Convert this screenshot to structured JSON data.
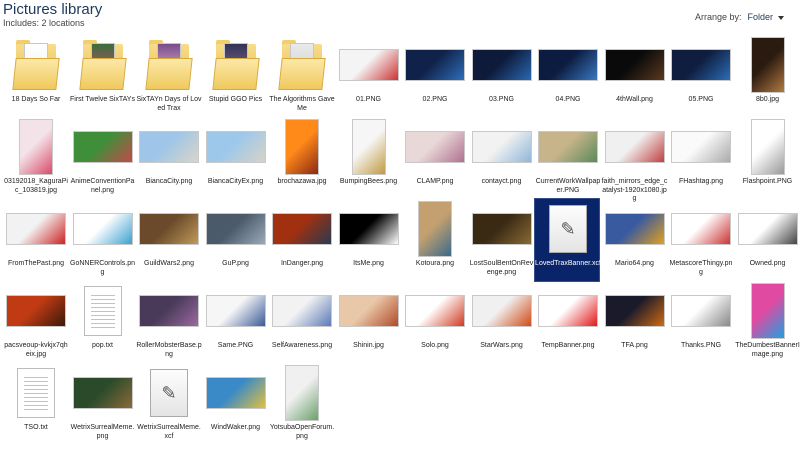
{
  "header": {
    "title": "Pictures library",
    "includes": "Includes:  2 locations",
    "arrange_label": "Arrange by:",
    "arrange_value": "Folder"
  },
  "items": [
    {
      "label": "18 Days So Far",
      "kind": "folder",
      "colors": [
        "#ffffff",
        "#f0f0f0"
      ]
    },
    {
      "label": "First Twelve SixTAYs",
      "kind": "folder",
      "colors": [
        "#3b6e3b",
        "#c84b6e"
      ]
    },
    {
      "label": "SixTAYn Days of Loved Trax",
      "kind": "folder",
      "colors": [
        "#7a4b8c",
        "#e0c0d0"
      ]
    },
    {
      "label": "Stupid GGO Pics",
      "kind": "folder",
      "colors": [
        "#333355",
        "#8a6a9a"
      ]
    },
    {
      "label": "The Algorithms Gave Me",
      "kind": "folder",
      "colors": [
        "#eaeaea",
        "#cfcfcf"
      ]
    },
    {
      "label": "01.PNG",
      "kind": "wide",
      "colors": [
        "#f4f4f4",
        "#cc3333"
      ]
    },
    {
      "label": "02.PNG",
      "kind": "wide",
      "colors": [
        "#10224a",
        "#2e6fb8"
      ]
    },
    {
      "label": "03.PNG",
      "kind": "wide",
      "colors": [
        "#0d1a3a",
        "#2a68b0"
      ]
    },
    {
      "label": "04.PNG",
      "kind": "wide",
      "colors": [
        "#0c1c40",
        "#3a78c0"
      ]
    },
    {
      "label": "4thWall.png",
      "kind": "wide",
      "colors": [
        "#0a0a0a",
        "#5a3a20"
      ]
    },
    {
      "label": "05.PNG",
      "kind": "wide",
      "colors": [
        "#0f1d3e",
        "#2c6db5"
      ]
    },
    {
      "label": "8b0.jpg",
      "kind": "tall",
      "colors": [
        "#2a1a10",
        "#b07a40"
      ]
    },
    {
      "label": "03192018_KaguraPic_103819.jpg",
      "kind": "tall",
      "colors": [
        "#f3e3e8",
        "#d94b6a"
      ]
    },
    {
      "label": "AnimeConventionPanel.png",
      "kind": "wide",
      "colors": [
        "#3f8f3a",
        "#c24a4a"
      ]
    },
    {
      "label": "BiancaCity.png",
      "kind": "wide",
      "colors": [
        "#9fc6e8",
        "#d9d4c8"
      ]
    },
    {
      "label": "BiancaCityEx.png",
      "kind": "wide",
      "colors": [
        "#9ec8ea",
        "#d8d3c6"
      ]
    },
    {
      "label": "brochazawa.jpg",
      "kind": "tall",
      "colors": [
        "#ff8a1a",
        "#8a2a14"
      ]
    },
    {
      "label": "BumpingBees.png",
      "kind": "tall",
      "colors": [
        "#f6f6f6",
        "#c09a40"
      ]
    },
    {
      "label": "CLAMP.png",
      "kind": "wide",
      "colors": [
        "#e8d8d8",
        "#b07090"
      ]
    },
    {
      "label": "contayct.png",
      "kind": "wide",
      "colors": [
        "#f2f2f2",
        "#8fb6d8"
      ]
    },
    {
      "label": "CurrentWorkWallpaper.PNG",
      "kind": "wide",
      "colors": [
        "#c8b48a",
        "#5a8a5a"
      ]
    },
    {
      "label": "faith_mirrors_edge_catalyst-1920x1080.jpg",
      "kind": "wide",
      "colors": [
        "#f0f0f0",
        "#c04040"
      ]
    },
    {
      "label": "FHashtag.png",
      "kind": "wide",
      "colors": [
        "#fafafa",
        "#aaaaaa"
      ]
    },
    {
      "label": "Flashpoint.PNG",
      "kind": "tall",
      "colors": [
        "#ffffff",
        "#999999"
      ]
    },
    {
      "label": "FromThePast.png",
      "kind": "wide",
      "colors": [
        "#f2f2f2",
        "#cc2222"
      ]
    },
    {
      "label": "GoNNERControls.png",
      "kind": "wide",
      "colors": [
        "#ffffff",
        "#3aa0d0"
      ]
    },
    {
      "label": "GuildWars2.png",
      "kind": "wide",
      "colors": [
        "#6a4a2a",
        "#c09a5a"
      ]
    },
    {
      "label": "GuP.png",
      "kind": "wide",
      "colors": [
        "#4a5a6a",
        "#9aaabb"
      ]
    },
    {
      "label": "InDanger.png",
      "kind": "wide",
      "colors": [
        "#a03010",
        "#2a3a50"
      ]
    },
    {
      "label": "ItsMe.png",
      "kind": "wide",
      "colors": [
        "#000000",
        "#ffffff"
      ]
    },
    {
      "label": "Kotoura.png",
      "kind": "tall",
      "colors": [
        "#c4a070",
        "#3a6a8a"
      ]
    },
    {
      "label": "LostSoulBentOnRevenge.png",
      "kind": "wide",
      "colors": [
        "#3a2a14",
        "#8a6a34"
      ]
    },
    {
      "label": "LovedTraxBanner.xcf",
      "kind": "xcf",
      "colors": [
        "#fdfdfd",
        "#555555"
      ],
      "selected": true
    },
    {
      "label": "Mario64.png",
      "kind": "wide",
      "colors": [
        "#3a5aa0",
        "#e0a020"
      ]
    },
    {
      "label": "MetascoreThingy.png",
      "kind": "wide",
      "colors": [
        "#ffffff",
        "#cc3333"
      ]
    },
    {
      "label": "Owned.png",
      "kind": "wide",
      "colors": [
        "#ffffff",
        "#444444"
      ]
    },
    {
      "label": "pacsveoup-kvkjx7qheix.jpg",
      "kind": "wide",
      "colors": [
        "#c03a14",
        "#3a1a0a"
      ]
    },
    {
      "label": "pop.txt",
      "kind": "doc",
      "colors": [
        "#ffffff",
        "#b7c3d7"
      ]
    },
    {
      "label": "RollerMobsterBase.png",
      "kind": "wide",
      "colors": [
        "#4a3a5a",
        "#9a6aa0"
      ]
    },
    {
      "label": "Same.PNG",
      "kind": "wide",
      "colors": [
        "#f6f6f6",
        "#3a5a9a"
      ]
    },
    {
      "label": "SelfAwareness.png",
      "kind": "wide",
      "colors": [
        "#f2f2f2",
        "#5a7ab8"
      ]
    },
    {
      "label": "Shinin.jpg",
      "kind": "wide",
      "colors": [
        "#e8c8a8",
        "#b04a2a"
      ]
    },
    {
      "label": "Solo.png",
      "kind": "wide",
      "colors": [
        "#ffffff",
        "#d03a20"
      ]
    },
    {
      "label": "StarWars.png",
      "kind": "wide",
      "colors": [
        "#f0f0f0",
        "#d04a14"
      ]
    },
    {
      "label": "TempBanner.png",
      "kind": "wide",
      "colors": [
        "#ffffff",
        "#e01818"
      ]
    },
    {
      "label": "TFA.png",
      "kind": "wide",
      "colors": [
        "#1a1a2a",
        "#d06a14"
      ]
    },
    {
      "label": "Thanks.PNG",
      "kind": "wide",
      "colors": [
        "#ffffff",
        "#888888"
      ]
    },
    {
      "label": "TheDumbestBannerImage.png",
      "kind": "tall",
      "colors": [
        "#e04aa0",
        "#20a0e0"
      ]
    },
    {
      "label": "TSO.txt",
      "kind": "doc",
      "colors": [
        "#ffffff",
        "#b7c3d7"
      ]
    },
    {
      "label": "WetrixSurrealMeme.png",
      "kind": "wide",
      "colors": [
        "#2a4a2a",
        "#8a6a3a"
      ]
    },
    {
      "label": "WetrixSurrealMeme.xcf",
      "kind": "xcf",
      "colors": [
        "#fdfdfd",
        "#555555"
      ]
    },
    {
      "label": "WindWaker.png",
      "kind": "wide",
      "colors": [
        "#3a8ac8",
        "#e0c040"
      ]
    },
    {
      "label": "YotsubaOpenForum.png",
      "kind": "tall",
      "colors": [
        "#f0f0f0",
        "#6aa06a"
      ]
    }
  ]
}
